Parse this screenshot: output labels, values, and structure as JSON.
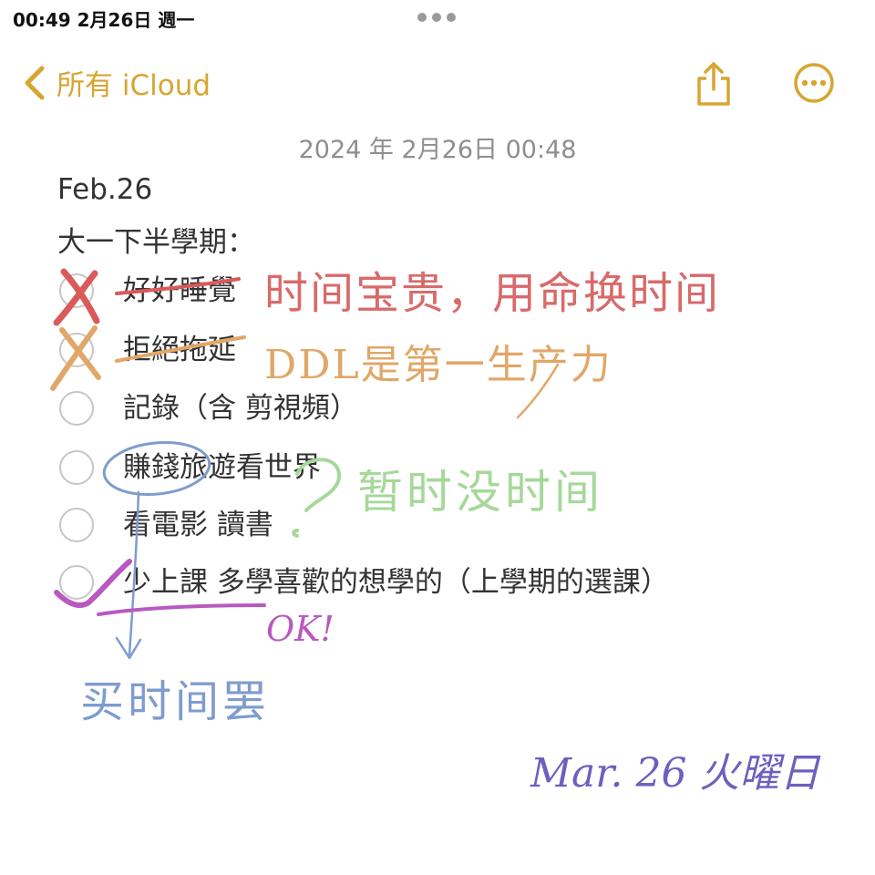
{
  "status_bar": {
    "time": "00:49   2月26日 週一"
  },
  "nav": {
    "back_label": "所有 iCloud"
  },
  "note": {
    "date": "2024 年 2月26日 00:48",
    "title_lines": [
      "Feb.26",
      "大一下半學期："
    ],
    "checklist": [
      {
        "label": "好好睡覺",
        "checked": false
      },
      {
        "label": "拒絕拖延",
        "checked": false
      },
      {
        "label": "記錄（含 剪視頻）",
        "checked": false
      },
      {
        "label": "賺錢旅遊看世界",
        "checked": false
      },
      {
        "label": "看電影 讀書",
        "checked": false
      },
      {
        "label": "少上課 多學喜歡的想學的（上學期的選課）",
        "checked": false
      }
    ]
  },
  "handwriting": {
    "red_note": "时间宝贵，用命换时间",
    "orange_note": "DDL是第一生产力",
    "green_note": "暂时没时间",
    "purple_note": "OK!",
    "blue_note": "买时间罢",
    "signature": "Mar. 26 火曜日"
  },
  "colors": {
    "accent": "#d7a531",
    "ink_red": "#d96a6a",
    "ink_orange": "#e0a768",
    "ink_green": "#a6d89a",
    "ink_purple": "#b859c0",
    "ink_blue": "#7e9ccd",
    "ink_indigo": "#6e5fbf"
  }
}
